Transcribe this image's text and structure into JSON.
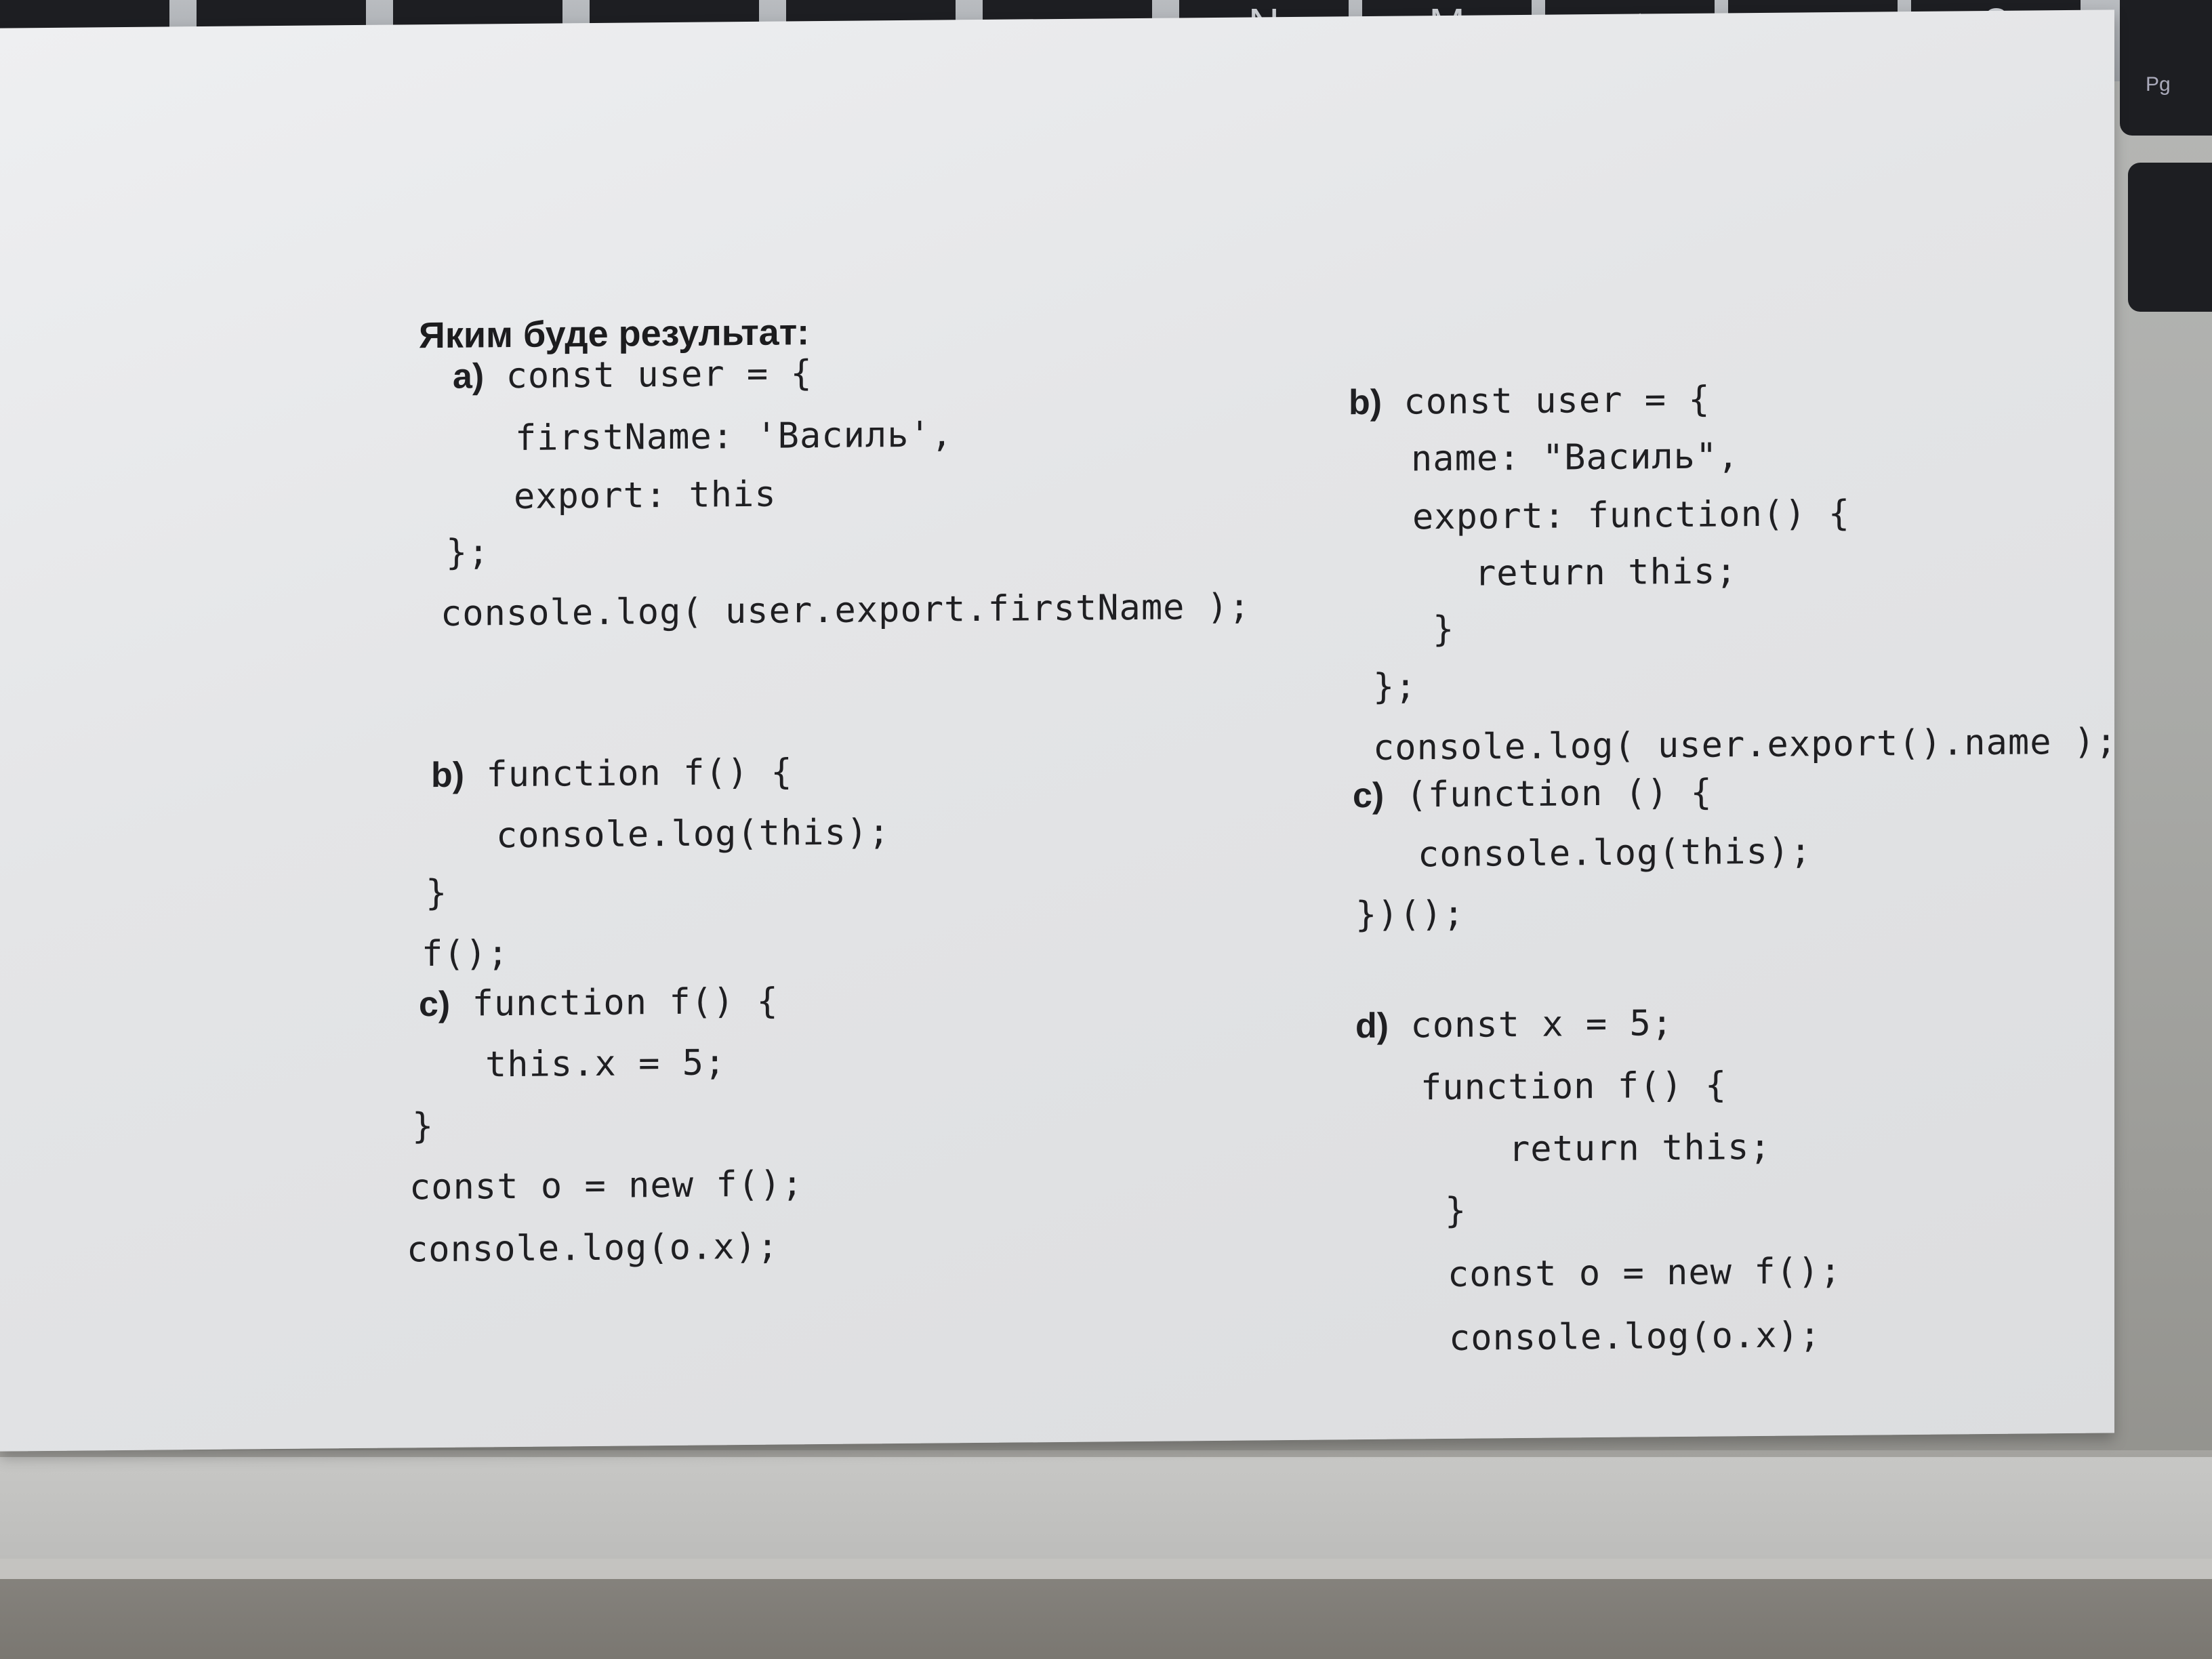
{
  "keyboard": {
    "keys": [
      "N",
      "M",
      "<",
      ">",
      "?"
    ],
    "right_key": "Pg"
  },
  "page": {
    "title": "Яким буде результат:"
  },
  "left_column": {
    "a": {
      "label": "a)",
      "lines": [
        "const user = {",
        "firstName: 'Василь',",
        "export: this",
        "};",
        "console.log( user.export.firstName );"
      ]
    },
    "b": {
      "label": "b)",
      "lines": [
        "function f() {",
        "console.log(this);",
        "}",
        "f();"
      ]
    },
    "c": {
      "label": "c)",
      "lines": [
        "function f() {",
        "this.x = 5;",
        "}",
        "const o = new f();",
        "console.log(o.x);"
      ]
    }
  },
  "right_column": {
    "b": {
      "label": "b)",
      "lines": [
        "const user = {",
        "name: \"Василь\",",
        "export: function() {",
        "return this;",
        "}",
        "};",
        "console.log( user.export().name );"
      ]
    },
    "c": {
      "label": "c)",
      "lines": [
        "(function () {",
        "console.log(this);",
        "})();"
      ]
    },
    "d": {
      "label": "d)",
      "lines": [
        "const x = 5;",
        "function f() {",
        "return this;",
        "}",
        "const o = new f();",
        "console.log(o.x);"
      ]
    }
  }
}
